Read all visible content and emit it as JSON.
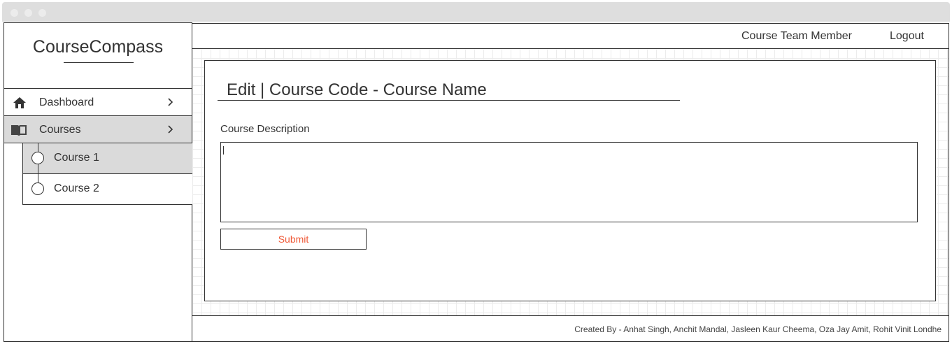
{
  "sidebar": {
    "brand": "CourseCompass",
    "items": [
      {
        "label": "Dashboard",
        "icon": "home-icon"
      },
      {
        "label": "Courses",
        "icon": "book-icon"
      }
    ],
    "sub_items": [
      {
        "label": "Course 1"
      },
      {
        "label": "Course 2"
      }
    ]
  },
  "header": {
    "role_link": "Course Team Member",
    "logout_link": "Logout"
  },
  "main": {
    "title": "Edit | Course Code - Course Name",
    "description_label": "Course Description",
    "description_value": "",
    "submit_label": "Submit"
  },
  "footer": {
    "credits": "Created By - Anhat Singh, Anchit Mandal, Jasleen Kaur Cheema, Oza Jay Amit, Rohit Vinit Londhe"
  },
  "colors": {
    "accent": "#ef5a38",
    "selected_bg": "#dadada",
    "window_bar": "#dedede"
  }
}
